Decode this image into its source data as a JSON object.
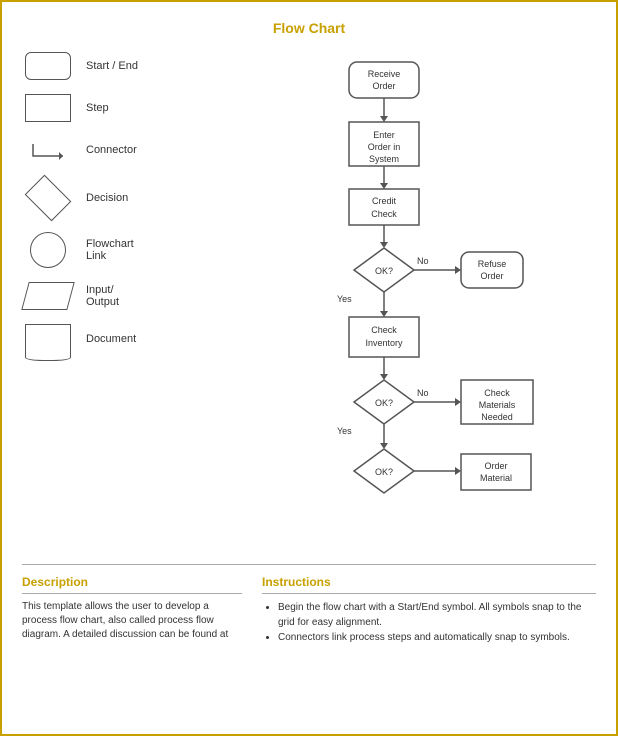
{
  "page": {
    "title": "Flow Chart"
  },
  "legend": {
    "items": [
      {
        "id": "start-end",
        "label": "Start / End",
        "shape": "rounded-rect"
      },
      {
        "id": "step",
        "label": "Step",
        "shape": "rect"
      },
      {
        "id": "connector",
        "label": "Connector",
        "shape": "connector"
      },
      {
        "id": "decision",
        "label": "Decision",
        "shape": "diamond"
      },
      {
        "id": "flowchart-link",
        "label": "Flowchart Link",
        "shape": "circle"
      },
      {
        "id": "input-output",
        "label": "Input/ Output",
        "shape": "parallelogram"
      },
      {
        "id": "document",
        "label": "Document",
        "shape": "document"
      }
    ]
  },
  "description": {
    "heading": "Description",
    "text": "This template allows the user to develop a process flow chart, also called process flow diagram. A detailed discussion can be found at"
  },
  "instructions": {
    "heading": "Instructions",
    "items": [
      "Begin the flow chart with a Start/End symbol. All symbols snap to the grid for easy alignment.",
      "Connectors link process steps and automatically snap to symbols."
    ]
  }
}
